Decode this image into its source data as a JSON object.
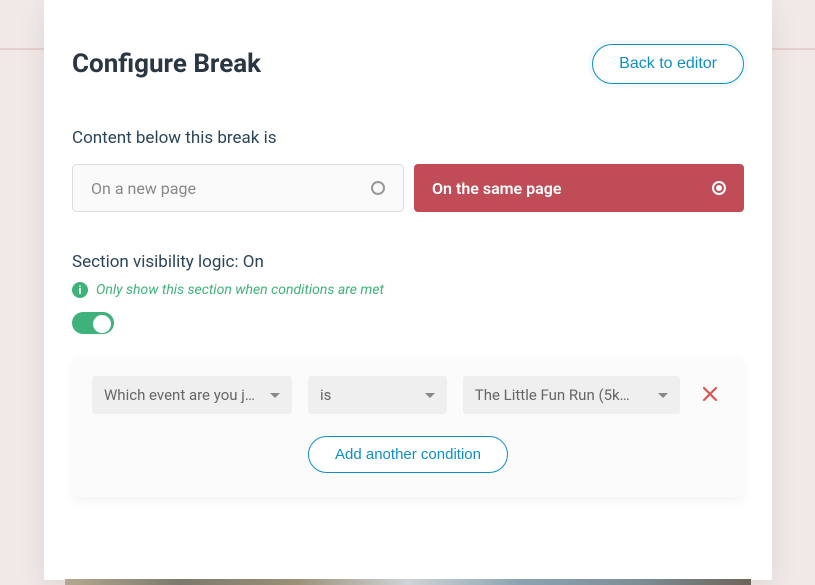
{
  "header": {
    "title": "Configure Break",
    "back_label": "Back to editor"
  },
  "content_break": {
    "label": "Content below this break is",
    "option_new_page": "On a new page",
    "option_same_page": "On the same page",
    "selected": "same_page"
  },
  "visibility": {
    "heading": "Section visibility logic: On",
    "hint": "Only show this section when conditions are met",
    "toggle_on": true
  },
  "condition": {
    "field": "Which event are you jo…",
    "operator": "is",
    "value": "The Little Fun Run (5k…",
    "add_label": "Add another condition"
  }
}
